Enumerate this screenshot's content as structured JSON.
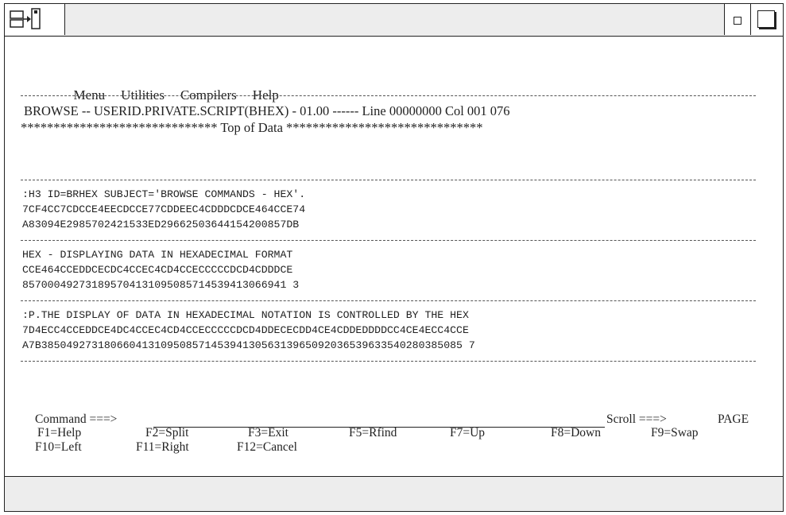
{
  "menu": {
    "items": [
      "Menu",
      "Utilities",
      "Compilers",
      "Help"
    ]
  },
  "header": {
    "browse_line": "BROWSE -- USERID.PRIVATE.SCRIPT(BHEX) - 01.00 ------ Line 00000000 Col 001 076",
    "top_of_data": "****************************** Top of Data ******************************"
  },
  "records": [
    {
      "text": ":H3 ID=BRHEX SUBJECT='BROWSE COMMANDS - HEX'.",
      "hex_high": "7CF4CC7CDCCE4EECDCCE77CDDEEC4CDDDCDCE464CCE74",
      "hex_low": "A83094E2985702421533ED29662503644154200857DB"
    },
    {
      "text": "HEX - DISPLAYING DATA IN HEXADECIMAL FORMAT",
      "hex_high": "CCE464CCEDDCECDC4CCEC4CD4CCECCCCCDCD4CDDDCE",
      "hex_low": "857000492731895704131095085714539413066941 3"
    },
    {
      "text": ":P.THE DISPLAY OF DATA IN HEXADECIMAL NOTATION IS CONTROLLED BY THE HEX",
      "hex_high": "7D4ECC4CCEDDCE4DC4CCEC4CD4CCECCCCCDCD4DDECECDD4CE4CDDEDDDDCC4CE4ECC4CCE",
      "hex_low": "A7B3850492731806604131095085714539413056313965092036539633540280385085 7"
    }
  ],
  "command": {
    "label": "Command ===>",
    "value": "",
    "scroll_label": "Scroll ===>",
    "scroll_value": "PAGE"
  },
  "fkeys_row1": [
    "F1=Help",
    "F2=Split",
    "F3=Exit",
    "F5=Rfind",
    "F7=Up",
    "F8=Down",
    "F9=Swap"
  ],
  "fkeys_row2": [
    "F10=Left",
    "F11=Right",
    "F12=Cancel"
  ]
}
